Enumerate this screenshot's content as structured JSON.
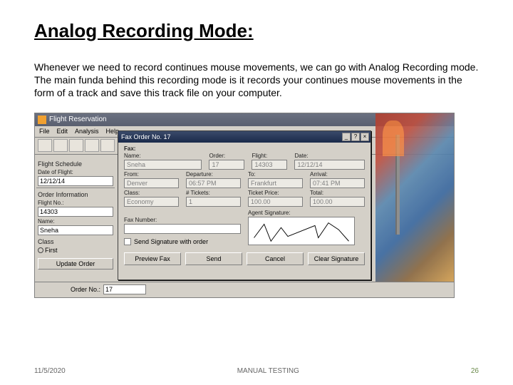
{
  "title": "Analog Recording Mode:",
  "body": "Whenever we need to record continues mouse movements, we can go with Analog Recording mode. The main funda behind this recording mode is it records your continues mouse movements in the form of a track and save this track file on your computer.",
  "app": {
    "bg_window_title": "Flight Reservation",
    "menu": [
      "File",
      "Edit",
      "Analysis",
      "Help"
    ],
    "left": {
      "schedule_label": "Flight Schedule",
      "dof_label": "Date of Flight:",
      "dof_value": "12/12/14",
      "order_info_label": "Order Information",
      "flight_no_label": "Flight No.:",
      "flight_no_value": "14303",
      "name_label": "Name:",
      "name_value": "Sneha",
      "class_label": "Class",
      "class_first": "First",
      "update_btn": "Update Order"
    },
    "fax": {
      "title": "Fax Order No. 17",
      "section": "Fax:",
      "name_label": "Name:",
      "name_value": "Sneha",
      "order_label": "Order:",
      "order_value": "17",
      "flight_label": "Flight:",
      "flight_value": "14303",
      "date_label": "Date:",
      "date_value": "12/12/14",
      "from_label": "From:",
      "from_value": "Denver",
      "departure_label": "Departure:",
      "departure_value": "06:57 PM",
      "to_label": "To:",
      "to_value": "Frankfurt",
      "arrival_label": "Arrival:",
      "arrival_value": "07:41 PM",
      "class_label": "Class:",
      "class_value": "Economy",
      "tickets_label": "# Tickets:",
      "tickets_value": "1",
      "price_label": "Ticket Price:",
      "price_value": "100.00",
      "total_label": "Total:",
      "total_value": "100.00",
      "faxnum_label": "Fax Number:",
      "faxnum_value": "",
      "sig_label": "Agent Signature:",
      "send_sig_label": "Send Signature with order",
      "btn_preview": "Preview Fax",
      "btn_send": "Send",
      "btn_cancel": "Cancel",
      "btn_clear": "Clear Signature"
    },
    "status": {
      "order_label": "Order No.:",
      "order_value": "17"
    }
  },
  "footer": {
    "date": "11/5/2020",
    "center": "MANUAL TESTING",
    "page": "26"
  }
}
